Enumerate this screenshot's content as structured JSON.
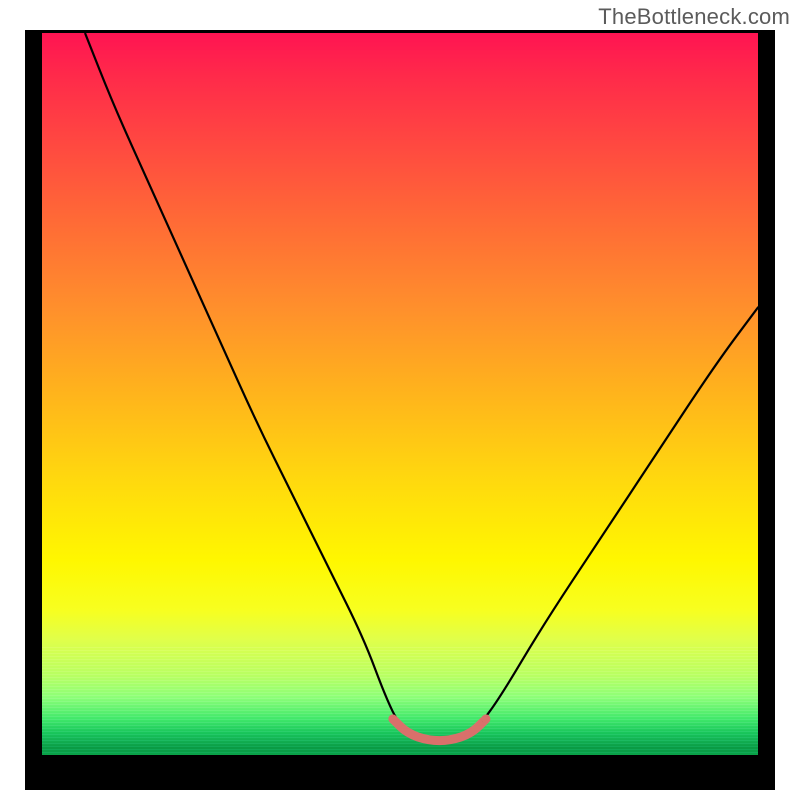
{
  "watermark": "TheBottleneck.com",
  "chart_data": {
    "type": "line",
    "title": "",
    "xlabel": "",
    "ylabel": "",
    "xlim": [
      0,
      100
    ],
    "ylim": [
      0,
      100
    ],
    "grid": false,
    "legend": false,
    "series": [
      {
        "name": "bottleneck-curve",
        "x": [
          6,
          10,
          15,
          20,
          25,
          30,
          35,
          40,
          45,
          48,
          50,
          53,
          56,
          59,
          61,
          64,
          70,
          78,
          86,
          94,
          100
        ],
        "y": [
          100,
          90,
          79,
          68,
          57,
          46,
          36,
          26,
          16,
          8,
          4,
          2,
          2,
          2,
          4,
          8,
          18,
          30,
          42,
          54,
          62
        ],
        "color": "#000000"
      },
      {
        "name": "valley-highlight",
        "x": [
          49,
          51,
          54,
          57,
          60,
          62
        ],
        "y": [
          5,
          3,
          2,
          2,
          3,
          5
        ],
        "color": "#d9706b"
      }
    ],
    "colors": {
      "top": "#ff1452",
      "mid": "#ffd90e",
      "bottom": "#0aa248",
      "highlight": "#d9706b"
    }
  }
}
